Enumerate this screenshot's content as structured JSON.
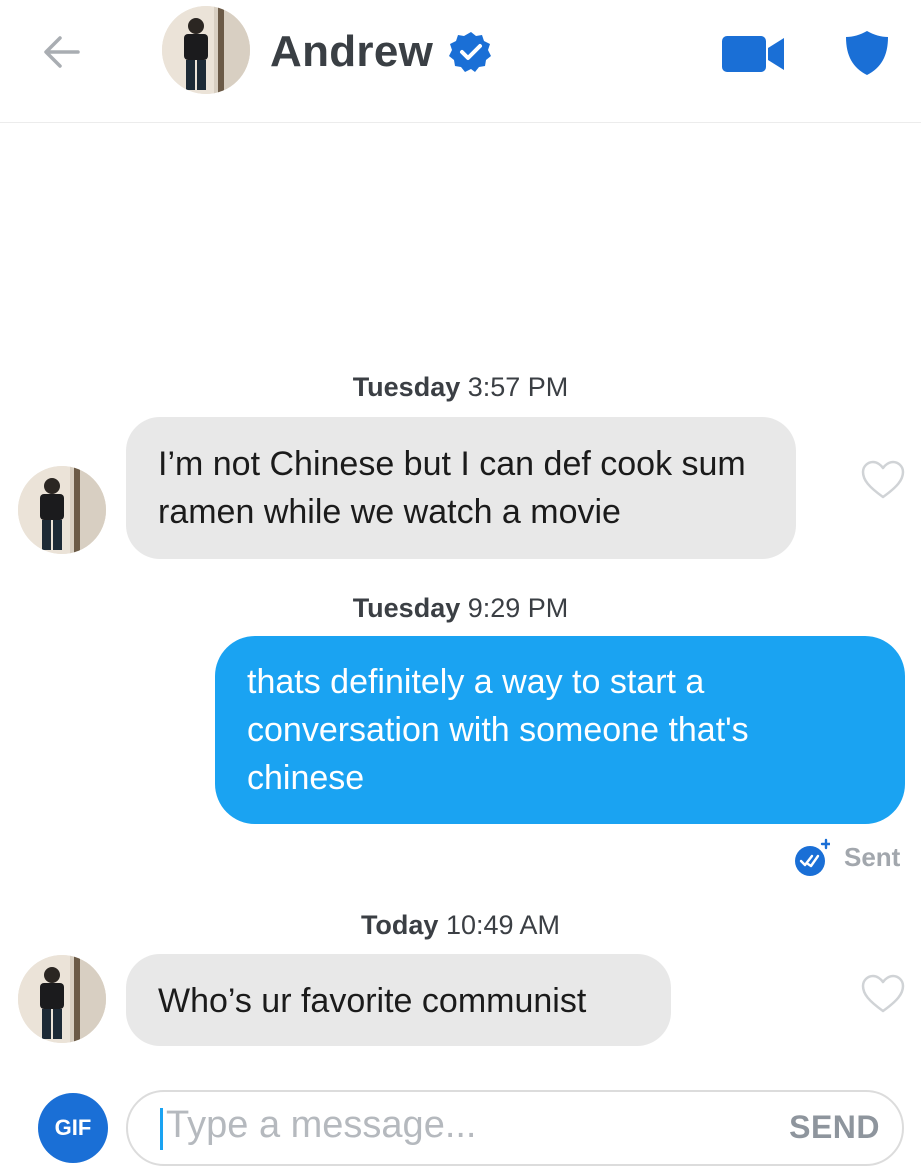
{
  "header": {
    "name": "Andrew",
    "icons": {
      "back": "arrow-left-icon",
      "verified": "verified-badge-icon",
      "video": "video-camera-icon",
      "safety": "shield-icon"
    }
  },
  "messages": [
    {
      "timestamp_day": "Tuesday",
      "timestamp_time": "3:57 PM",
      "direction": "incoming",
      "text": "I’m not Chinese but I can def cook sum ramen while we watch a movie"
    },
    {
      "timestamp_day": "Tuesday",
      "timestamp_time": "9:29 PM",
      "direction": "outgoing",
      "text": "thats definitely a way to start a conversation with someone that's chinese",
      "status": "Sent"
    },
    {
      "timestamp_day": "Today",
      "timestamp_time": "10:49 AM",
      "direction": "incoming",
      "text": "Who’s ur favorite communist"
    }
  ],
  "composer": {
    "gif_label": "GIF",
    "placeholder": "Type a message...",
    "send_label": "SEND"
  },
  "colors": {
    "outgoing_bubble": "#1aa3f2",
    "incoming_bubble": "#e8e8e8",
    "accent_blue": "#1a6fd6",
    "muted_text": "#a2a7ad"
  }
}
